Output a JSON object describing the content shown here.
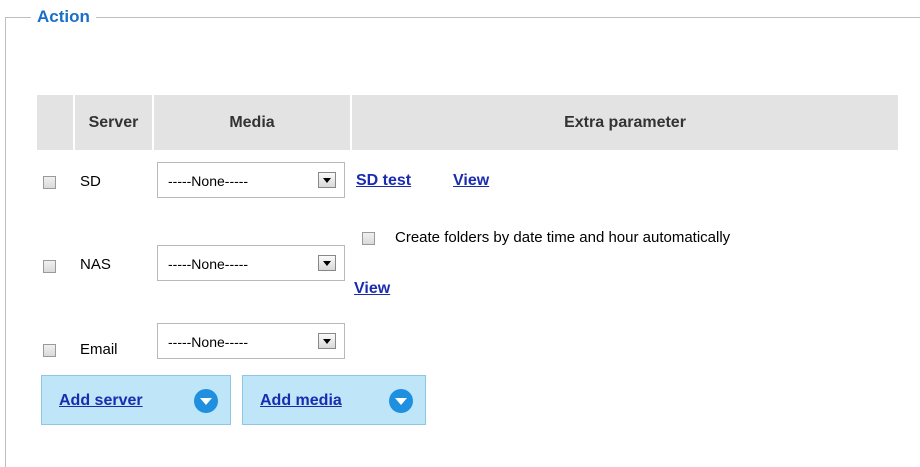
{
  "legend": "Action",
  "table": {
    "headers": [
      "Server",
      "Media",
      "Extra parameter"
    ]
  },
  "rows": {
    "sd": {
      "label": "SD",
      "media": "-----None-----",
      "links": [
        "SD test",
        "View"
      ]
    },
    "nas": {
      "label": "NAS",
      "media": "-----None-----",
      "checkbox_label": "Create folders by date time and hour automatically",
      "link": "View"
    },
    "email": {
      "label": "Email",
      "media": "-----None-----"
    }
  },
  "buttons": {
    "add_server": "Add server",
    "add_media": "Add media"
  }
}
